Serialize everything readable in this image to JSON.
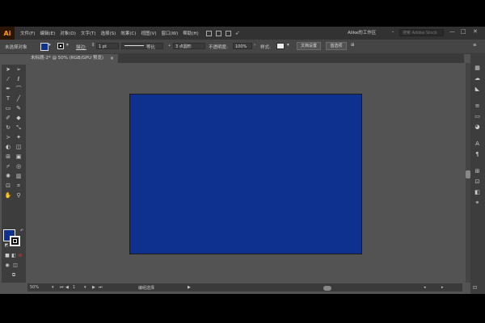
{
  "menubar": {
    "logo": "Ai",
    "items": [
      "文件(F)",
      "编辑(E)",
      "对象(O)",
      "文字(T)",
      "选择(S)",
      "效果(C)",
      "视图(V)",
      "窗口(W)",
      "帮助(H)"
    ],
    "workspace": "Alike的工作区",
    "workspace_arrow": "⌄",
    "search_placeholder": "搜索 Adobe Stock",
    "window_controls": [
      "—",
      "□",
      "✕"
    ]
  },
  "controlbar": {
    "selection_state": "未选择对象",
    "stroke_label": "描边:",
    "stroke_weight": "1 pt",
    "stroke_profile": "等比",
    "brush": "3 点圆形",
    "opacity_label": "不透明度:",
    "opacity_value": "100%",
    "style_label": "样式:",
    "doc_setup_button": "文档设置",
    "preferences_button": "首选项"
  },
  "document_tab": {
    "title": "未标题-2* @ 50% (RGB/GPU 预览)",
    "close": "×"
  },
  "statusbar": {
    "zoom": "50%",
    "page": "1",
    "tool_name": "编组选择",
    "play_icon": "▶"
  },
  "colors": {
    "fill": "#0e308f",
    "stroke": "#111111",
    "app_bg": "#535353",
    "panel_bg": "#3d3d3d",
    "artboard_fill": "#0e308f"
  },
  "icons": {
    "tools": [
      "selection-icon",
      "direct-selection-icon",
      "magic-wand-icon",
      "lasso-icon",
      "pen-icon",
      "curvature-icon",
      "type-icon",
      "line-icon",
      "rectangle-icon",
      "paintbrush-icon",
      "shaper-icon",
      "eraser-icon",
      "rotate-icon",
      "scale-icon",
      "width-icon",
      "puppet-warp-icon",
      "shape-builder-icon",
      "perspective-icon",
      "mesh-icon",
      "gradient-icon",
      "eyedropper-icon",
      "blend-icon",
      "symbol-sprayer-icon",
      "column-graph-icon",
      "artboard-icon",
      "slice-icon",
      "hand-icon",
      "zoom-icon"
    ],
    "right_panel": [
      "color-panel-icon",
      "swatches-icon",
      "brushes-icon",
      "stroke-icon",
      "gradient-panel-icon",
      "transparency-icon",
      "appearance-icon",
      "character-icon",
      "paragraph-icon",
      "align-icon",
      "transform-icon",
      "pathfinder-icon",
      "links-icon"
    ]
  }
}
